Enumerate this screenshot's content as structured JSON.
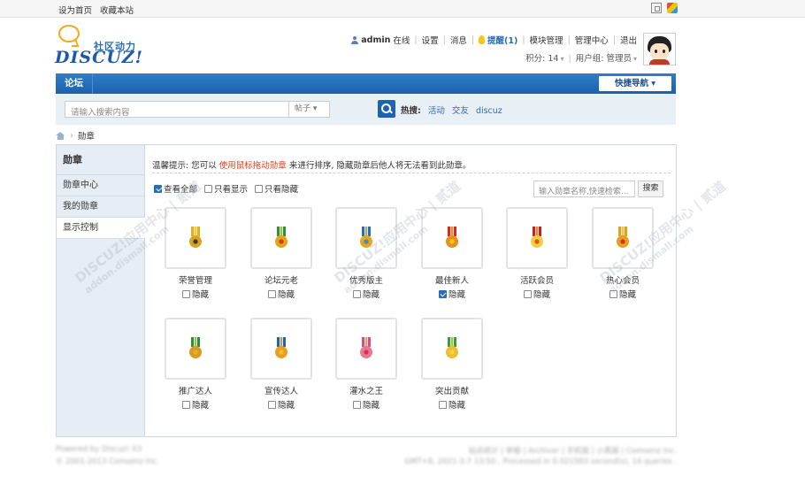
{
  "topbar": {
    "set_home": "设为首页",
    "bookmark": "收藏本站"
  },
  "logo": {
    "slogan": "社区动力",
    "word": "DISCUZ!"
  },
  "user": {
    "name": "admin",
    "status": "在线",
    "settings": "设置",
    "messages": "消息",
    "remind": "提醒(1)",
    "module_manage": "模块管理",
    "admin_center": "管理中心",
    "logout": "退出",
    "credits": "积分: 14",
    "group": "用户组: 管理员"
  },
  "nav": {
    "forum": "论坛",
    "quick_nav": "快捷导航 ▾"
  },
  "search": {
    "placeholder": "请输入搜索内容",
    "type": "帖子 ▾",
    "hot_label": "热搜:",
    "hot": [
      "活动",
      "交友",
      "discuz"
    ]
  },
  "breadcrumb": {
    "current": "勋章"
  },
  "sidebar": {
    "title": "勋章",
    "items": [
      "勋章中心",
      "我的勋章",
      "显示控制"
    ],
    "active_index": 2
  },
  "content": {
    "tip_prefix": "温馨提示: 您可以",
    "tip_link": "使用鼠标拖动勋章",
    "tip_suffix": "来进行排序, 隐藏勋章后他人将无法看到此勋章。",
    "filters": [
      {
        "label": "查看全部",
        "checked": true
      },
      {
        "label": "只看显示",
        "checked": false
      },
      {
        "label": "只看隐藏",
        "checked": false
      }
    ],
    "medal_search_placeholder": "输入勋章名称,快速检索...",
    "medal_search_button": "搜索",
    "hide_label": "隐藏",
    "medals": [
      {
        "name": "荣誉管理",
        "hidden": false,
        "ribbon": "#e0b020",
        "disc": "#d7a51c",
        "center": "#3a3a3a"
      },
      {
        "name": "论坛元老",
        "hidden": false,
        "ribbon": "#2f8f3a",
        "disc": "#e8a21a",
        "center": "#c8401c"
      },
      {
        "name": "优秀版主",
        "hidden": false,
        "ribbon": "#2a6db5",
        "disc": "#e3a81d",
        "center": "#4c88c8"
      },
      {
        "name": "最佳新人",
        "hidden": true,
        "ribbon": "#d8281c",
        "disc": "#e8911a",
        "center": "#f3c230"
      },
      {
        "name": "活跃会员",
        "hidden": false,
        "ribbon": "#c8201c",
        "disc": "#f0d040",
        "center": "#e85020"
      },
      {
        "name": "热心会员",
        "hidden": false,
        "ribbon": "#e0a020",
        "disc": "#e8a020",
        "center": "#d83020"
      },
      {
        "name": "推广达人",
        "hidden": false,
        "ribbon": "#2a8f3a",
        "disc": "#d89a20",
        "center": "#e0b030"
      },
      {
        "name": "宣传达人",
        "hidden": false,
        "ribbon": "#2a5fb0",
        "disc": "#e8a020",
        "center": "#f0c030"
      },
      {
        "name": "灌水之王",
        "hidden": false,
        "ribbon": "#d84a8c",
        "disc": "#e87890",
        "center": "#d83050"
      },
      {
        "name": "突出贡献",
        "hidden": false,
        "ribbon": "#3a9f3a",
        "disc": "#e8c030",
        "center": "#f5d050"
      }
    ]
  },
  "footer": {
    "powered": "Powered by Discuz! X3",
    "copyright": "© 2001-2013 Comsenz Inc.",
    "links": "站点统计 | 举报 | Archiver | 手机版 | 小黑屋 | Comsenz Inc.",
    "gmt": "GMT+8, 2021-3-7 13:50 , Processed in 0.021583 second(s), 14 queries ."
  },
  "watermark": {
    "line1": "DISCUZ!应用中心 | 贰道",
    "line2": "addon.dismall.com"
  }
}
